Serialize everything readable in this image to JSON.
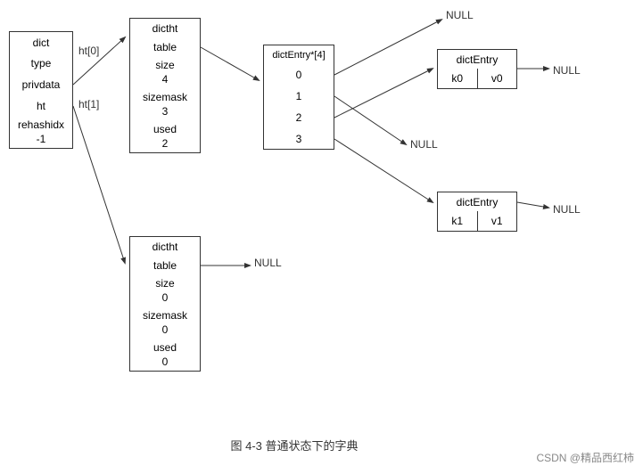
{
  "diagram": {
    "title": "图 4-3    普通状态下的字典",
    "watermark": "CSDN @精品西红柿",
    "dict_box": {
      "fields": [
        "dict",
        "type",
        "privdata",
        "ht",
        "rehashidx\n-1"
      ]
    },
    "ht_labels": {
      "ht0": "ht[0]",
      "ht1": "ht[1]"
    },
    "dictht_top": {
      "fields": [
        "dictht",
        "table",
        "size\n4",
        "sizemask\n3",
        "used\n2"
      ]
    },
    "dictht_bottom": {
      "fields": [
        "dictht",
        "table",
        "size\n0",
        "sizemask\n0",
        "used\n0"
      ]
    },
    "dictentry_array": {
      "header": "dictEntry*[4]",
      "items": [
        "0",
        "1",
        "2",
        "3"
      ]
    },
    "dictentry_top": {
      "label": "dictEntry",
      "fields": [
        "k0",
        "v0"
      ]
    },
    "dictentry_bottom": {
      "label": "dictEntry",
      "fields": [
        "k1",
        "v1"
      ]
    },
    "nulls": [
      "NULL",
      "NULL",
      "NULL",
      "NULL",
      "NULL"
    ]
  }
}
